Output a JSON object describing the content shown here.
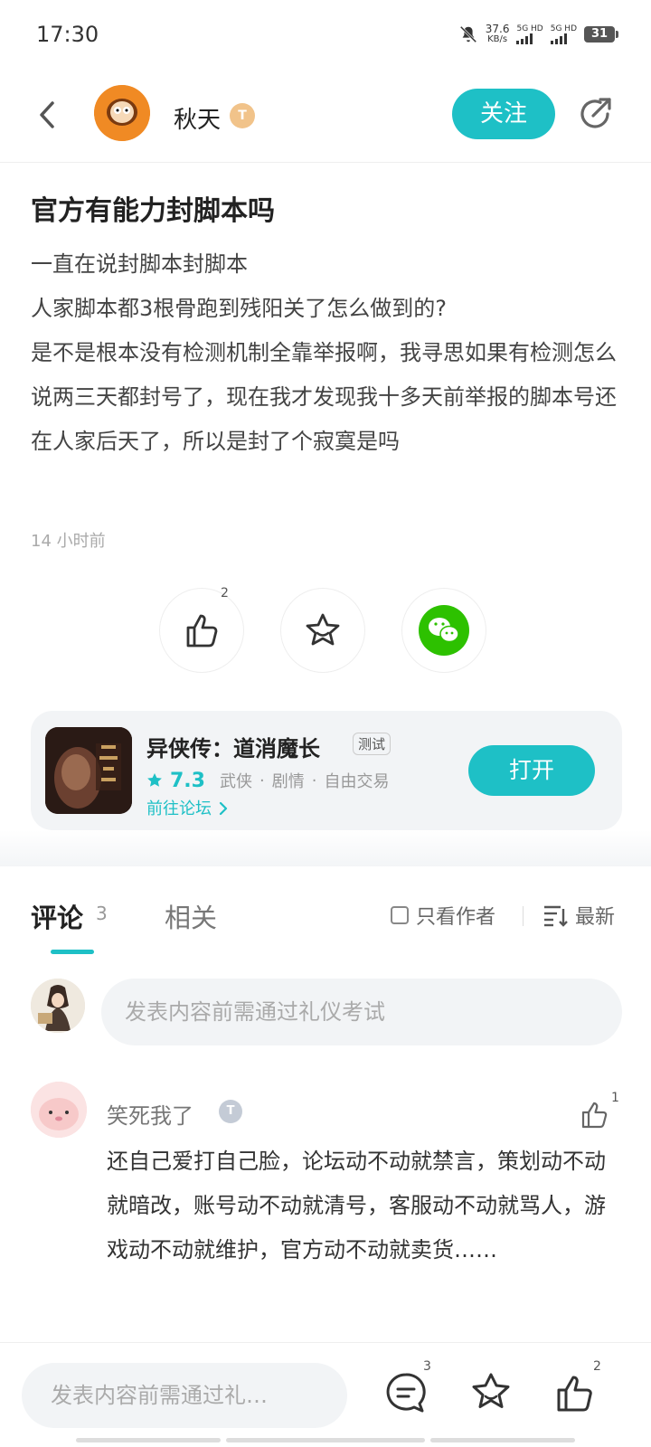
{
  "status": {
    "time": "17:30",
    "netspeed_value": "37.6",
    "netspeed_unit": "KB/s",
    "sim1": "5G HD",
    "sim2": "5G HD",
    "battery": "31"
  },
  "header": {
    "author": "秋天",
    "level": "T",
    "follow": "关注"
  },
  "post": {
    "title": "官方有能力封脚本吗",
    "paragraphs": [
      "一直在说封脚本封脚本",
      "人家脚本都3根骨跑到残阳关了怎么做到的?",
      "是不是根本没有检测机制全靠举报啊，我寻思如果有检测怎么说两三天都封号了，现在我才发现我十多天前举报的脚本号还在人家后天了，所以是封了个寂寞是吗"
    ],
    "time": "14 小时前",
    "like_count": "2"
  },
  "game": {
    "name": "异侠传：道消魔长",
    "tag": "测试",
    "rating": "7.3",
    "genre1": "武侠",
    "genre2": "剧情",
    "genre3": "自由交易",
    "sep": "·",
    "forum_link": "前往论坛",
    "open": "打开"
  },
  "tabs": {
    "comments": "评论",
    "comments_count": "3",
    "related": "相关",
    "author_only": "只看作者",
    "sort": "最新"
  },
  "comment_input": {
    "placeholder": "发表内容前需通过礼仪考试"
  },
  "comment": {
    "name": "笑死我了",
    "level": "T",
    "like_count": "1",
    "text": "还自己爱打自己脸，论坛动不动就禁言，策划动不动就暗改，账号动不动就清号，客服动不动就骂人，游戏动不动就维护，官方动不动就卖货……"
  },
  "bottom": {
    "input_placeholder": "发表内容前需通过礼…",
    "comment_count": "3",
    "like_count": "2"
  },
  "colors": {
    "accent": "#1ec0c6",
    "wechat": "#2dc100"
  }
}
